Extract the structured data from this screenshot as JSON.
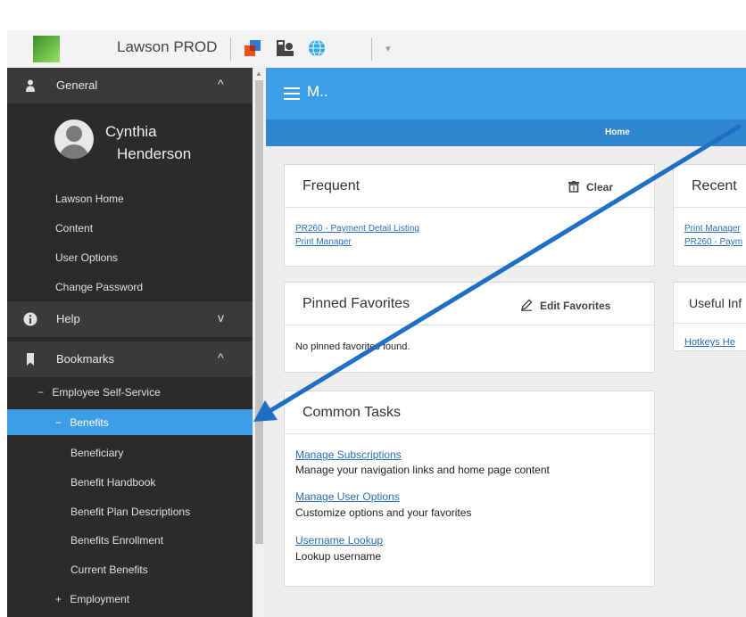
{
  "topbar": {
    "app_title": "Lawson PROD"
  },
  "sidebar": {
    "general": {
      "label": "General",
      "chevron": "^"
    },
    "user": {
      "first_name": "Cynthia",
      "last_name": "Henderson"
    },
    "links": [
      "Lawson Home",
      "Content",
      "User Options",
      "Change Password"
    ],
    "help": {
      "label": "Help",
      "chevron": "v"
    },
    "bookmarks": {
      "label": "Bookmarks",
      "chevron": "^"
    },
    "tree": {
      "employee_self_service": {
        "marker": "−",
        "label": "Employee Self-Service"
      },
      "benefits": {
        "marker": "−",
        "label": "Benefits"
      },
      "children": [
        "Beneficiary",
        "Benefit Handbook",
        "Benefit Plan Descriptions",
        "Benefits Enrollment",
        "Current Benefits"
      ],
      "employment": {
        "marker": "+",
        "label": "Employment"
      }
    }
  },
  "main": {
    "title": "M..",
    "home_tab": "Home",
    "frequent": {
      "title": "Frequent",
      "action": "Clear",
      "links": [
        "PR260 - Payment Detail Listing",
        "Print Manager"
      ]
    },
    "recent": {
      "title": "Recent",
      "links": [
        "Print Manager",
        "PR260 - Paym"
      ]
    },
    "pinned": {
      "title": "Pinned Favorites",
      "action": "Edit Favorites",
      "empty_text": "No pinned favorites found."
    },
    "useful": {
      "title": "Useful Inf",
      "link": "Hotkeys He"
    },
    "common_tasks": {
      "title": "Common Tasks",
      "items": [
        {
          "link": "Manage Subscriptions",
          "desc": "Manage your navigation links and home page content"
        },
        {
          "link": "Manage User Options",
          "desc": "Customize options and your favorites"
        },
        {
          "link": "Username Lookup",
          "desc": "Lookup username"
        }
      ]
    }
  },
  "colors": {
    "accent": "#3d9ee5",
    "nav_strip": "#2f86cf",
    "sidebar_bg": "#2b2b2b",
    "sidebar_section": "#3a3a3a",
    "annotation_arrow": "#1f6fc4"
  }
}
